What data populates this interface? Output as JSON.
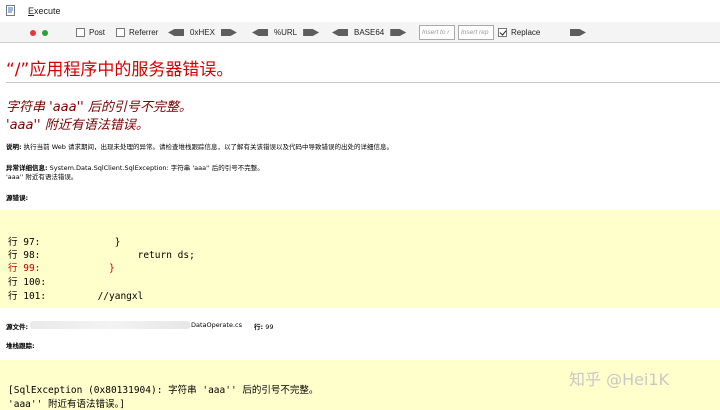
{
  "toolbar": {
    "execute_label_underlined": "E",
    "execute_label_rest": "xecute",
    "options": [
      {
        "label": "Post",
        "checked": false
      },
      {
        "label": "Referrer",
        "checked": false
      }
    ],
    "encoders": [
      "0xHEX",
      "%URL",
      "BASE64"
    ],
    "insert_placeholder_1": "Insert to r",
    "insert_placeholder_2": "Insert rep",
    "replace_label": "Replace",
    "replace_checked": true,
    "colors": {
      "toolbar_bg": "#f4f4f4",
      "dot_red": "#e03a3a",
      "dot_green": "#2e9e3a"
    }
  },
  "page": {
    "title": "“/”应用程序中的服务器错误。",
    "error_line1": "字符串 'aaa'' 后的引号不完整。",
    "error_line2": "'aaa'' 附近有语法错误。",
    "description_label": "说明:",
    "description_text": " 执行当前 Web 请求期间，出现未处理的异常。请检查堆栈跟踪信息，以了解有关该错误以及代码中导致错误的出处的详细信息。",
    "exception_label": "异常详细信息:",
    "exception_text": " System.Data.SqlClient.SqlException: 字符串 'aaa'' 后的引号不完整。",
    "exception_text2": "'aaa'' 附近有语法错误。",
    "source_error_label": "源错误:",
    "source_lines": [
      {
        "text": "行 97:             }",
        "highlight": false
      },
      {
        "text": "行 98:                 return ds;",
        "highlight": false
      },
      {
        "text": "行 99:            }",
        "highlight": true
      },
      {
        "text": "行 100:",
        "highlight": false
      },
      {
        "text": "行 101:         //yangxl",
        "highlight": false
      }
    ],
    "source_file_label": "源文件:",
    "source_file_name": "DataOperate.cs",
    "source_line_label": "行:",
    "source_line_value": "99",
    "stack_trace_label": "堆栈跟踪:",
    "stack_lines": [
      "[SqlException (0x80131904): 字符串 'aaa'' 后的引号不完整。",
      "'aaa'' 附近有语法错误。]"
    ],
    "colors": {
      "title": "#d40000",
      "error": "#7b0000",
      "code_bg": "#ffffcc",
      "highlight": "#c00000"
    }
  },
  "watermark": "知乎 @Hei1K"
}
